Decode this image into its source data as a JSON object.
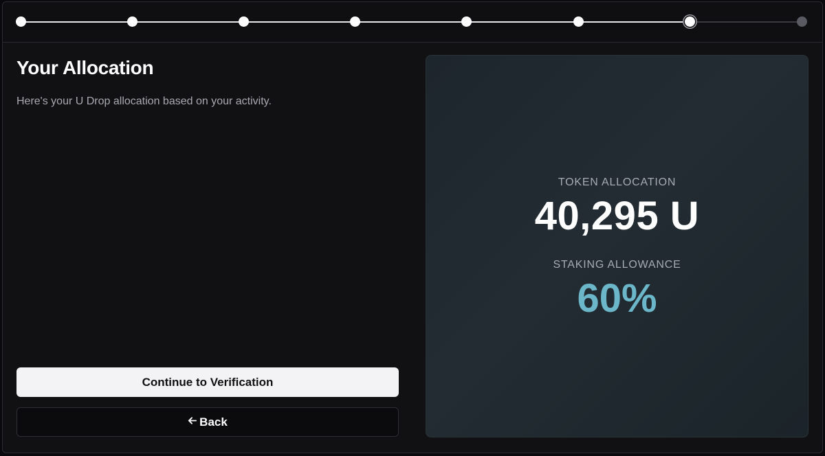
{
  "stepper": {
    "total_steps": 8,
    "completed_steps": 6,
    "current_step": 7
  },
  "header": {
    "title": "Your Allocation",
    "subtitle": "Here's your U Drop allocation based on your activity."
  },
  "actions": {
    "continue_label": "Continue to Verification",
    "back_label": "Back",
    "back_icon": "arrow-left-icon"
  },
  "allocation": {
    "token_label": "TOKEN ALLOCATION",
    "token_value": "40,295 U",
    "staking_label": "STAKING ALLOWANCE",
    "staking_value": "60%"
  },
  "colors": {
    "accent": "#6cb6c9",
    "background": "#111114",
    "panel": "#1f282e"
  }
}
